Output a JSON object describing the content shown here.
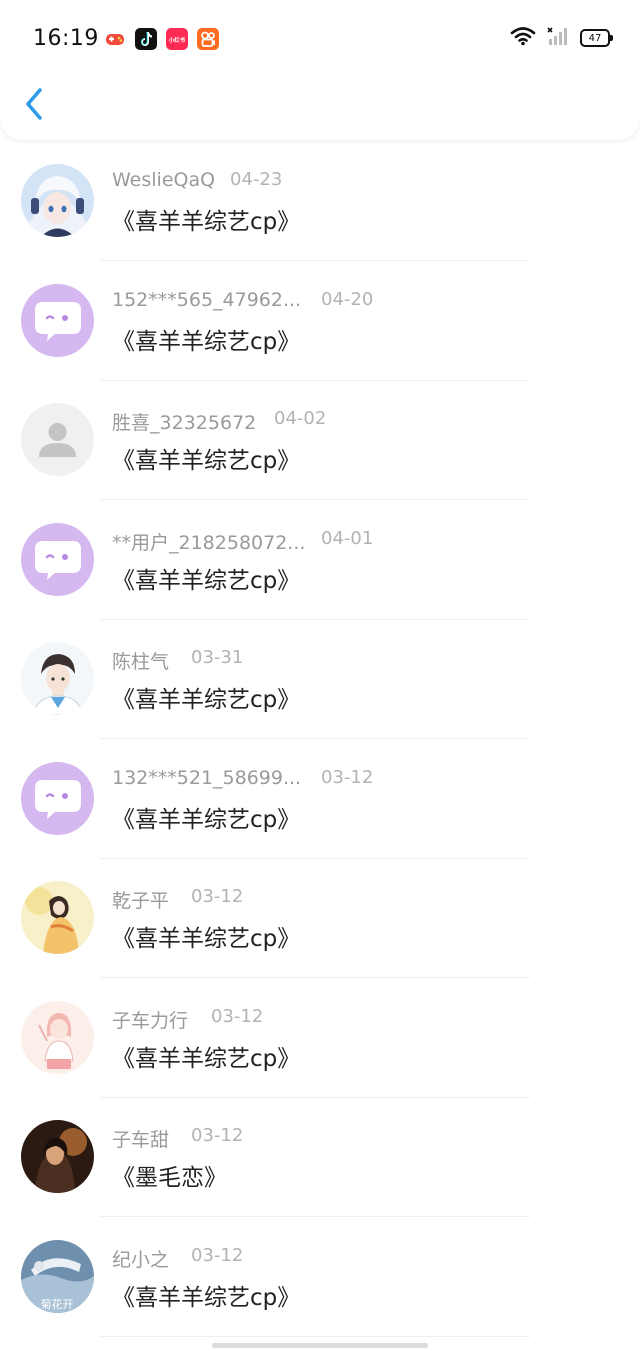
{
  "status_bar": {
    "time": "16:19",
    "battery": "47",
    "app_icons": [
      "game-icon",
      "douyin-icon",
      "xiaohongshu-icon",
      "kuaishou-icon"
    ],
    "xiaohongshu_label": "小红书"
  },
  "header": {
    "back_icon": "chevron-left-icon",
    "accent": "#2d9ce8"
  },
  "comments": [
    {
      "name": "WeslieQaQ",
      "date": "04-23",
      "message": "《喜羊羊综艺cp》",
      "avatar": "anime-boy-white-hair"
    },
    {
      "name": "152***565_47962...",
      "date": "04-20",
      "message": "《喜羊羊综艺cp》",
      "avatar": "default-chat-bubble"
    },
    {
      "name": "胜喜_32325672",
      "date": "04-02",
      "message": "《喜羊羊综艺cp》",
      "avatar": "default-person"
    },
    {
      "name": "**用户_218258072...",
      "date": "04-01",
      "message": "《喜羊羊综艺cp》",
      "avatar": "default-chat-bubble"
    },
    {
      "name": "陈柱气",
      "date": "03-31",
      "message": "《喜羊羊综艺cp》",
      "avatar": "anime-boy-blue"
    },
    {
      "name": "132***521_58699...",
      "date": "03-12",
      "message": "《喜羊羊综艺cp》",
      "avatar": "default-chat-bubble"
    },
    {
      "name": "乾子平",
      "date": "03-12",
      "message": "《喜羊羊综艺cp》",
      "avatar": "anime-girl-yellow"
    },
    {
      "name": "子车力行",
      "date": "03-12",
      "message": "《喜羊羊综艺cp》",
      "avatar": "anime-girl-pink"
    },
    {
      "name": "子车甜",
      "date": "03-12",
      "message": "《墨毛恋》",
      "avatar": "dark-photo"
    },
    {
      "name": "纪小之",
      "date": "03-12",
      "message": "《喜羊羊综艺cp》",
      "avatar": "photo-with-text",
      "avatar_text": "菊花开"
    }
  ]
}
